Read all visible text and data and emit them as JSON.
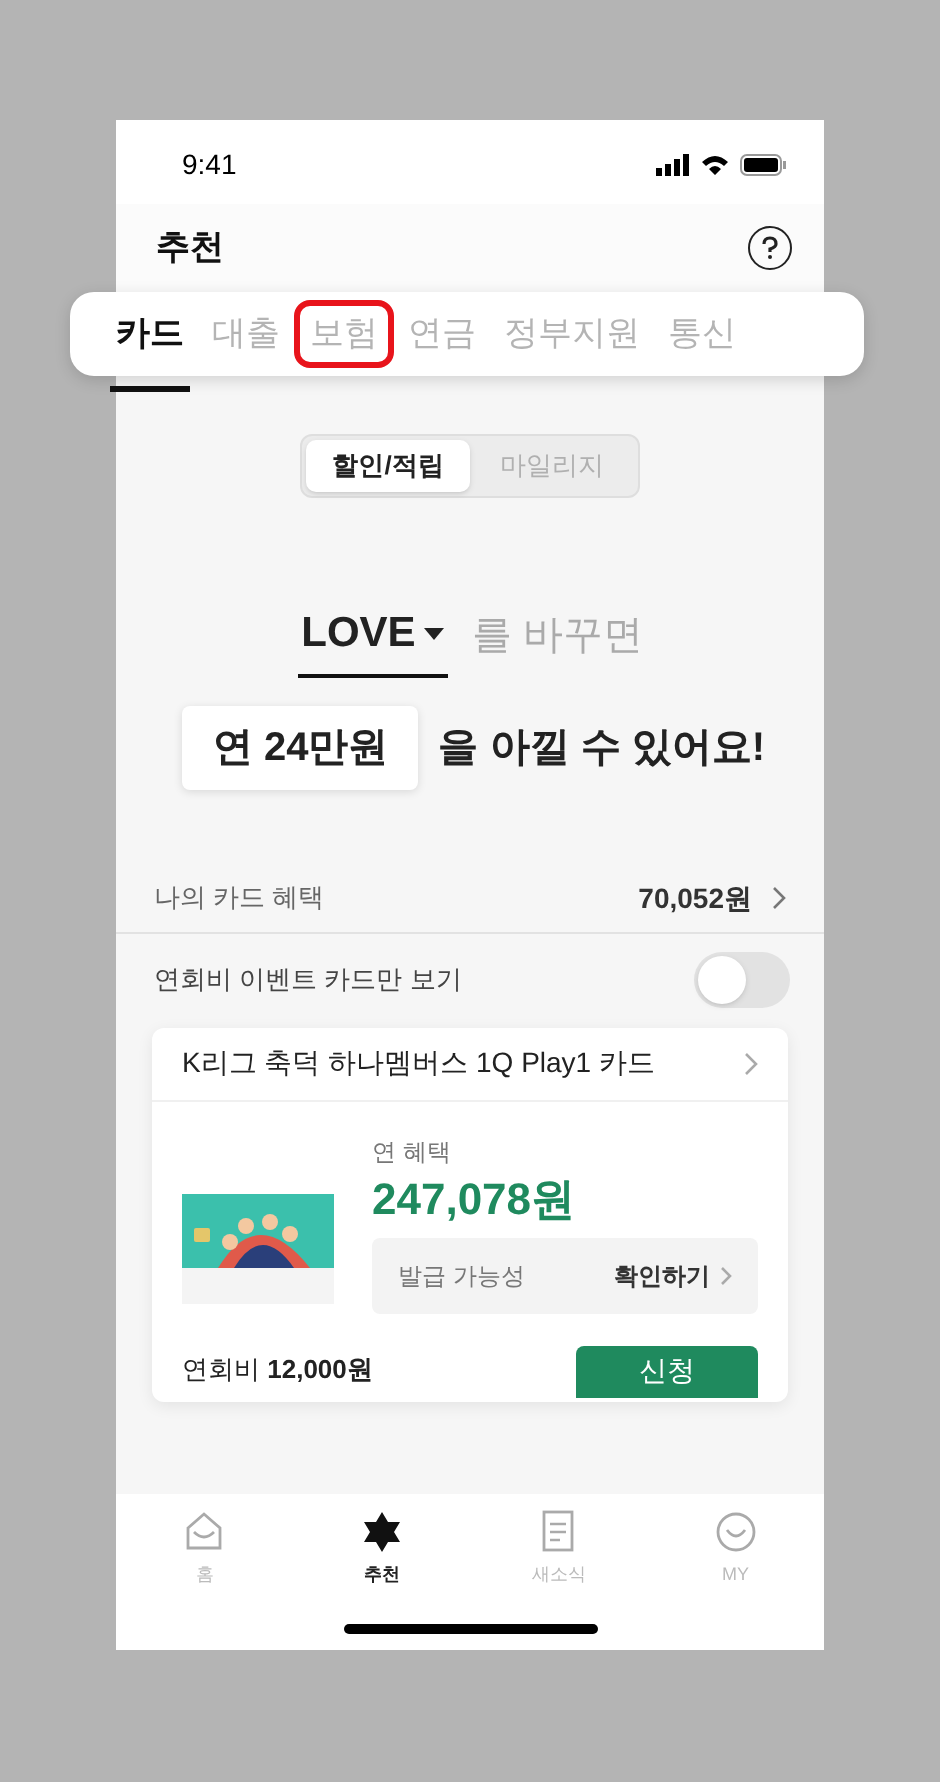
{
  "status_bar": {
    "time": "9:41"
  },
  "header": {
    "title": "추천"
  },
  "tabs": [
    {
      "label": "카드",
      "selected": true,
      "highlighted": false
    },
    {
      "label": "대출",
      "selected": false,
      "highlighted": false
    },
    {
      "label": "보험",
      "selected": false,
      "highlighted": true
    },
    {
      "label": "연금",
      "selected": false,
      "highlighted": false
    },
    {
      "label": "정부지원",
      "selected": false,
      "highlighted": false
    },
    {
      "label": "통신",
      "selected": false,
      "highlighted": false
    }
  ],
  "segments": [
    {
      "label": "할인/적립",
      "selected": true
    },
    {
      "label": "마일리지",
      "selected": false
    }
  ],
  "headline": {
    "card_name": "LOVE",
    "suffix": "를 바꾸면",
    "amount": "연 24만원",
    "message": "을 아낄 수 있어요!"
  },
  "my_benefit": {
    "label": "나의 카드 혜택",
    "value": "70,052원"
  },
  "event_filter": {
    "label": "연회비 이벤트 카드만 보기",
    "on": false
  },
  "cards": [
    {
      "name": "K리그 축덕 하나멤버스 1Q Play1 카드",
      "benefit_label": "연 혜택",
      "benefit": "247,078원",
      "issue_label": "발급 가능성",
      "issue_action": "확인하기",
      "fee": "연회비 **12,000원**",
      "apply": "신청"
    }
  ],
  "bottom_nav": [
    {
      "kind": "home",
      "label": "홈",
      "selected": false
    },
    {
      "kind": "star",
      "label": "추천",
      "selected": true
    },
    {
      "kind": "news",
      "label": "새소식",
      "selected": false
    },
    {
      "kind": "my",
      "label": "MY",
      "selected": false
    }
  ]
}
